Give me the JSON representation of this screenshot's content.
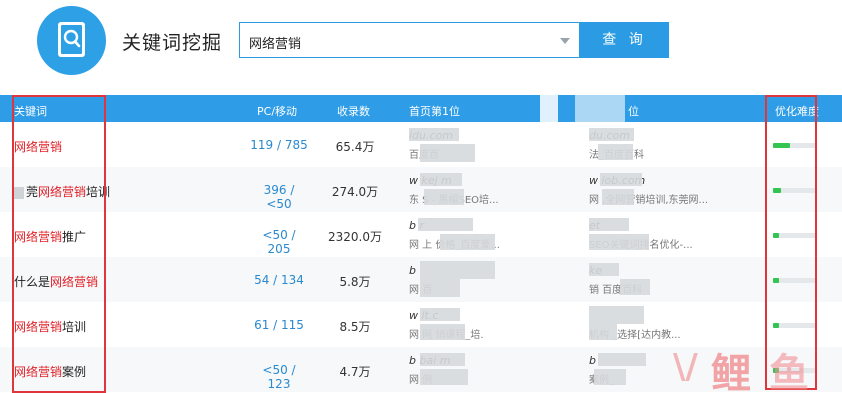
{
  "header": {
    "title": "关键词挖掘",
    "search_value": "网络营销",
    "search_button": "查 询"
  },
  "table": {
    "columns": {
      "keyword": "关键词",
      "pc_mobile": "PC/移动",
      "count": "收录数",
      "first": "首页第1位",
      "second": "位",
      "difficulty": "优化难度"
    },
    "rows": [
      {
        "pre": "",
        "hl": "网络营销",
        "post": "",
        "pc_mobile": "119 / 785",
        "count": "65.4万",
        "site1_url": "idu.com",
        "site1_desc": "百度百",
        "site2_url": "du.com",
        "site2_desc": "法_百度百科",
        "difficulty": 0.4
      },
      {
        "pre": "莞",
        "hl": "网络营销",
        "post": "培训",
        "pc_mobile": "396 / <50",
        "count": "274.0万",
        "site1_url": "w        kej    m",
        "site1_desc": "东        S      - 黑帽SEO培...",
        "site2_url": "w           iob.com",
        "site2_desc": "网      ,全网营销培训,东莞网...",
        "difficulty": 0.18
      },
      {
        "pre": "",
        "hl": "网络营销",
        "post": "推广",
        "pc_mobile": "<50 / 205",
        "count": "2320.0万",
        "site1_url": "b               r",
        "site1_desc": "网        上      价格_百度爱...",
        "site2_url": "              et",
        "site2_desc": "          SEO关键词排名优化-...",
        "difficulty": 0.15
      },
      {
        "pre": "什么是",
        "hl": "网络营销",
        "post": "",
        "pc_mobile": "54 / 134",
        "count": "5.8万",
        "site1_url": "b",
        "site1_desc": "网        百",
        "site2_url": "      ke",
        "site2_desc": "      销        百度百科",
        "difficulty": 0.15
      },
      {
        "pre": "",
        "hl": "网络营销",
        "post": "培训",
        "pc_mobile": "61 / 115",
        "count": "8.5万",
        "site1_url": "w         lt.c",
        "site1_desc": "网        网   销课程_培.",
        "site2_url": "",
        "site2_desc": "       机构 _选择[达内教...",
        "difficulty": 0.15
      },
      {
        "pre": "",
        "hl": "网络营销",
        "post": "案例",
        "pc_mobile": "<50 / 123",
        "count": "4.7万",
        "site1_url": "b          bai        m",
        "site1_desc": "网        例",
        "site2_url": "b",
        "site2_desc": "      案例_",
        "difficulty": 0.15
      }
    ]
  },
  "watermark": {
    "v": "\\/",
    "li": "鲤",
    "yu": "鱼"
  },
  "colors": {
    "accent": "#2b9be3",
    "highlight": "#e21f26",
    "difficulty": "#32c552",
    "annotation": "#e0353a"
  }
}
